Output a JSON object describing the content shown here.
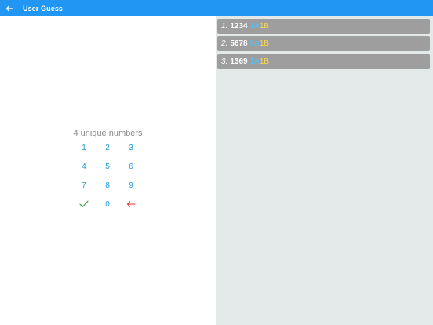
{
  "appbar": {
    "back_icon": "arrow-left-icon",
    "title": "User Guess",
    "color": "#2196f3"
  },
  "keypad": {
    "hint": "4 unique numbers",
    "digits": [
      "1",
      "2",
      "3",
      "4",
      "5",
      "6",
      "7",
      "8",
      "9",
      "0"
    ],
    "confirm_icon": "check-icon",
    "delete_icon": "backspace-arrow-icon",
    "digit_color": "#1e9ad6",
    "confirm_color": "#43a047",
    "delete_color": "#e53935"
  },
  "guesses": [
    {
      "index": "1.",
      "number": "1234",
      "a": "1A",
      "b": "1B"
    },
    {
      "index": "2.",
      "number": "5678",
      "a": "0A",
      "b": "1B"
    },
    {
      "index": "3.",
      "number": "1369",
      "a": "1A",
      "b": "1B"
    }
  ],
  "colors": {
    "a_result": "#4fc3f7",
    "b_result": "#ffd54f",
    "guess_bg": "#9e9e9e",
    "history_bg": "#e3e9e9"
  }
}
